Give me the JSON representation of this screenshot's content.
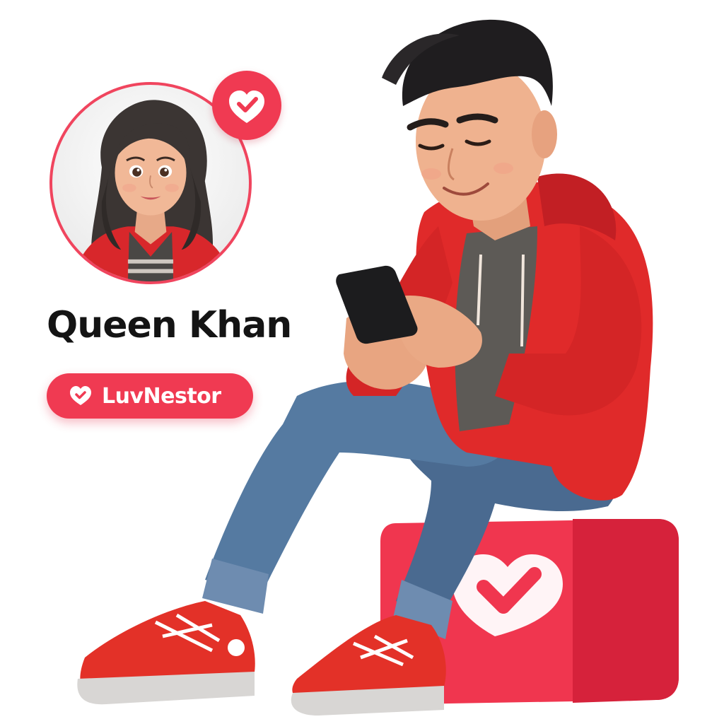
{
  "profile": {
    "name": "Queen Khan",
    "avatar_icon": "woman-portrait-icon",
    "verified_icon": "heart-check-icon"
  },
  "brand": {
    "label": "LuvNestor",
    "icon": "heart-check-icon",
    "accent_color": "#f03a52"
  },
  "illustration": {
    "subject_icon": "man-with-phone-illustration",
    "seat_icon": "heart-check-cube-icon",
    "hoodie_color": "#e02a2a",
    "jeans_color": "#49698f"
  }
}
